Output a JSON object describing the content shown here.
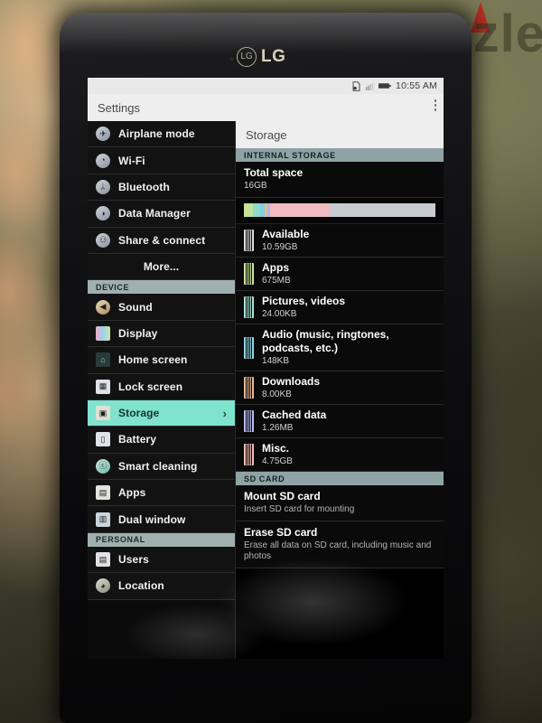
{
  "device": {
    "brand": "LG"
  },
  "statusbar": {
    "time": "10:55 AM",
    "icons": [
      "sd-card-icon",
      "signal-icon",
      "battery-icon"
    ]
  },
  "actionbar": {
    "title": "Settings",
    "overflow": "overflow-menu"
  },
  "sidebar": {
    "items": [
      {
        "label": "Airplane mode",
        "icon": "airplane-icon",
        "type": "item",
        "selected": false
      },
      {
        "label": "Wi-Fi",
        "icon": "wifi-icon",
        "type": "item",
        "selected": false
      },
      {
        "label": "Bluetooth",
        "icon": "bluetooth-icon",
        "type": "item",
        "selected": false
      },
      {
        "label": "Data Manager",
        "icon": "data-manager-icon",
        "type": "item",
        "selected": false
      },
      {
        "label": "Share & connect",
        "icon": "share-connect-icon",
        "type": "item",
        "selected": false
      },
      {
        "label": "More...",
        "icon": "",
        "type": "more",
        "selected": false
      },
      {
        "label": "DEVICE",
        "icon": "",
        "type": "header",
        "selected": false
      },
      {
        "label": "Sound",
        "icon": "sound-icon",
        "type": "item",
        "selected": false
      },
      {
        "label": "Display",
        "icon": "display-icon",
        "type": "item",
        "selected": false
      },
      {
        "label": "Home screen",
        "icon": "home-screen-icon",
        "type": "item",
        "selected": false
      },
      {
        "label": "Lock screen",
        "icon": "lock-screen-icon",
        "type": "item",
        "selected": false
      },
      {
        "label": "Storage",
        "icon": "storage-icon",
        "type": "item",
        "selected": true,
        "chevron": "›"
      },
      {
        "label": "Battery",
        "icon": "battery-icon",
        "type": "item",
        "selected": false
      },
      {
        "label": "Smart cleaning",
        "icon": "smart-cleaning-icon",
        "type": "item",
        "selected": false
      },
      {
        "label": "Apps",
        "icon": "apps-icon",
        "type": "item",
        "selected": false
      },
      {
        "label": "Dual window",
        "icon": "dual-window-icon",
        "type": "item",
        "selected": false
      },
      {
        "label": "PERSONAL",
        "icon": "",
        "type": "header",
        "selected": false
      },
      {
        "label": "Users",
        "icon": "users-icon",
        "type": "item",
        "selected": false
      },
      {
        "label": "Location",
        "icon": "location-icon",
        "type": "item",
        "selected": false
      }
    ]
  },
  "detail": {
    "title": "Storage",
    "sections": [
      {
        "header": "INTERNAL STORAGE",
        "total": {
          "title": "Total space",
          "value": "16GB"
        },
        "usage_bar": [
          {
            "name": "Apps",
            "color": "#c6e29a",
            "pct": 4.5
          },
          {
            "name": "Pictures, videos",
            "color": "#8fd9cf",
            "pct": 4.0
          },
          {
            "name": "Audio",
            "color": "#7fcfe0",
            "pct": 2.5
          },
          {
            "name": "Downloads",
            "color": "#e3bb96",
            "pct": 1.2
          },
          {
            "name": "Cached data",
            "color": "#b3b6e6",
            "pct": 1.5
          },
          {
            "name": "Misc.",
            "color": "#f0bcc0",
            "pct": 31.0
          },
          {
            "name": "Free",
            "color": "#c9cbd2",
            "pct": 55.3
          }
        ],
        "items": [
          {
            "title": "Available",
            "value": "10.59GB",
            "color": "#d8d8d8"
          },
          {
            "title": "Apps",
            "value": "675MB",
            "color": "#c6e29a"
          },
          {
            "title": "Pictures, videos",
            "value": "24.00KB",
            "color": "#a4ddd0"
          },
          {
            "title": "Audio (music, ringtones, podcasts, etc.)",
            "value": "148KB",
            "color": "#86cfdf"
          },
          {
            "title": "Downloads",
            "value": "8.00KB",
            "color": "#e0b28c"
          },
          {
            "title": "Cached data",
            "value": "1.26MB",
            "color": "#b0b4e8"
          },
          {
            "title": "Misc.",
            "value": "4.75GB",
            "color": "#eeb5ae"
          }
        ]
      },
      {
        "header": "SD CARD",
        "actions": [
          {
            "title": "Mount SD card",
            "subtitle": "Insert SD card for mounting"
          },
          {
            "title": "Erase SD card",
            "subtitle": "Erase all data on SD card, including music and photos"
          }
        ]
      }
    ]
  },
  "navbar": {
    "buttons": [
      {
        "name": "back-button",
        "glyph": "◁"
      },
      {
        "name": "home-button",
        "glyph": "○"
      },
      {
        "name": "recent-apps-button",
        "glyph": "□"
      },
      {
        "name": "dual-window-button",
        "glyph": "⊞"
      }
    ]
  },
  "watermark": {
    "text": "zzle"
  }
}
